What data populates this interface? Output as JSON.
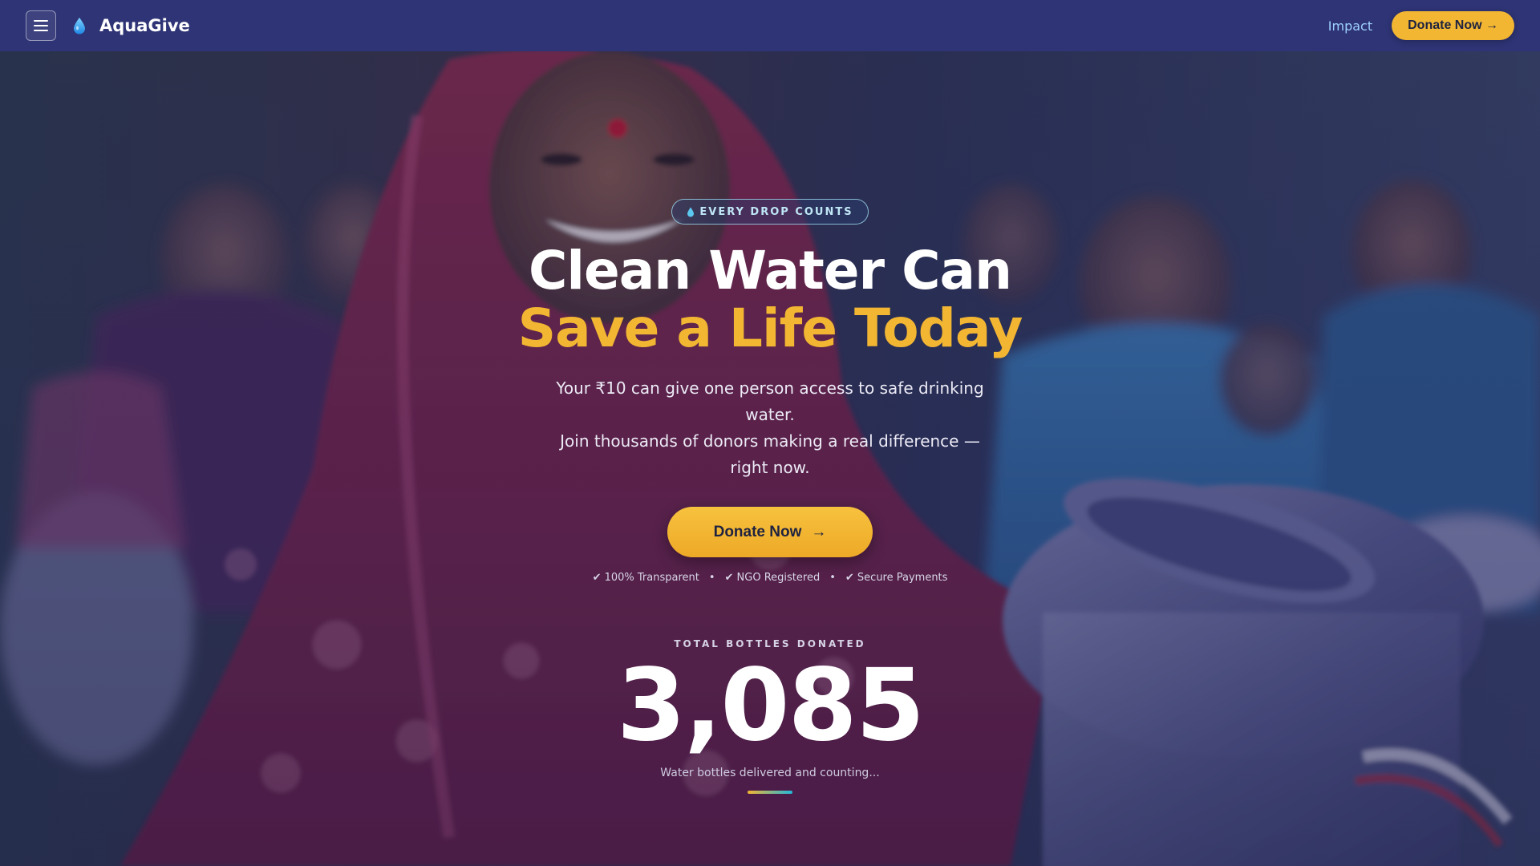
{
  "brand": {
    "name": "AquaGive",
    "logo_icon": "water-drop-icon",
    "accent_color": "#f2b632",
    "nav_color": "#2e3475"
  },
  "nav": {
    "menu_icon": "hamburger-menu-icon",
    "links": [
      {
        "label": "Impact"
      }
    ],
    "donate_label": "Donate Now →"
  },
  "hero": {
    "tag": "EVERY DROP COUNTS",
    "tag_icon": "water-drop-icon",
    "headline_line1": "Clean Water Can",
    "headline_line2": "Save a Life Today",
    "subtext_line1": "Your ₹10 can give one person access to safe drinking water.",
    "subtext_line2": "Join thousands of donors making a real difference — right now.",
    "cta_label": "Donate Now",
    "cta_arrow": "→",
    "trust_items": [
      "✔ 100% Transparent",
      "✔ NGO Registered",
      "✔ Secure Payments"
    ],
    "trust_separator": "•",
    "background_image": "photo of smiling women in saris holding metal water pots"
  },
  "stats": {
    "label": "TOTAL BOTTLES DONATED",
    "value": "3,085",
    "caption": "Water bottles delivered and counting..."
  }
}
